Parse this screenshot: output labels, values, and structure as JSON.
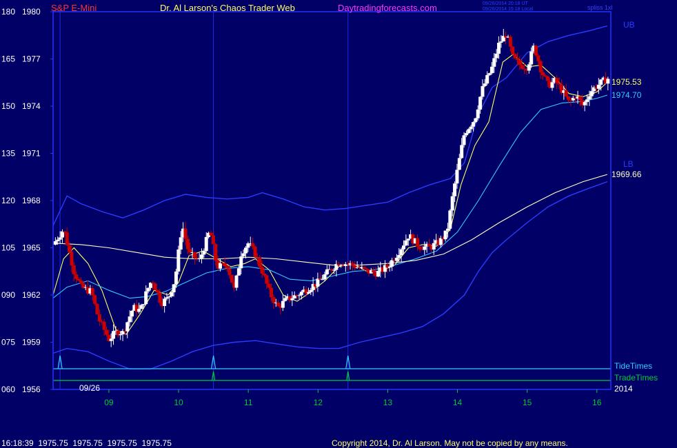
{
  "header": {
    "symbol": "S&P E-Mini",
    "author": "Dr. Al Larson's Chaos Trader Web",
    "site": "Daytradingforecasts.com",
    "timestamp_ut": "09/26/2014 20:18 UT",
    "timestamp_local": "09/26/2014 15:18 Local",
    "chart_id": "spliss 1xl"
  },
  "footer": {
    "last_tick": "16:18:39  1975.75  1975.75  1975.75  1975.75",
    "copyright": "Copyright 2014, Dr. Al Larson. May not be copied by any means."
  },
  "colors": {
    "background": "#000066",
    "frame": "#2233ff",
    "up_bar": "#ffffff",
    "down_bar": "#cc0000",
    "fast_avg": "#ffff66",
    "mid_avg": "#33ccff",
    "slow_avg": "#ffffcc",
    "band": "#2a3cff",
    "tide": "#33ccff",
    "trade": "#00cc33",
    "x_tick": "#00cc33"
  },
  "chart_data": {
    "type": "candlestick",
    "x_unit": "day",
    "x_labels": [
      {
        "x": 9,
        "label": "09"
      },
      {
        "x": 10,
        "label": "10"
      },
      {
        "x": 11,
        "label": "11"
      },
      {
        "x": 12,
        "label": "12"
      },
      {
        "x": 13,
        "label": "13"
      },
      {
        "x": 14,
        "label": "14"
      },
      {
        "x": 15,
        "label": "15"
      },
      {
        "x": 16,
        "label": "16"
      }
    ],
    "xlim": [
      8.2,
      16.2
    ],
    "ylim": [
      1956,
      1980
    ],
    "y_ticks": [
      {
        "left": "180",
        "price": "1980",
        "value": 1980
      },
      {
        "left": "165",
        "price": "1977",
        "value": 1977
      },
      {
        "left": "150",
        "price": "1974",
        "value": 1974
      },
      {
        "left": "135",
        "price": "1971",
        "value": 1971
      },
      {
        "left": "120",
        "price": "1968",
        "value": 1968
      },
      {
        "left": "105",
        "price": "1965",
        "value": 1965
      },
      {
        "left": "090",
        "price": "1962",
        "value": 1962
      },
      {
        "left": "075",
        "price": "1959",
        "value": 1959
      },
      {
        "left": "060",
        "price": "1956",
        "value": 1956
      }
    ],
    "date_label": "09/26",
    "year_label": "2014",
    "band_labels": {
      "upper": "UB",
      "lower": "LB"
    },
    "value_labels": [
      {
        "text": "1975.53",
        "value": 1975.53,
        "series": "fast"
      },
      {
        "text": "1974.70",
        "value": 1974.7,
        "series": "mid"
      },
      {
        "text": "1969.66",
        "value": 1969.66,
        "series": "slow"
      }
    ],
    "event_lines": {
      "tide_label": "TideTimes",
      "trade_label": "TradeTimes",
      "tide_spikes": [
        8.3,
        10.5,
        12.43
      ],
      "trade_spikes": [
        10.5,
        12.43
      ],
      "vertical_markers": [
        8.3,
        10.5,
        12.43
      ]
    },
    "price_path": [
      [
        8.2,
        1965.2
      ],
      [
        8.35,
        1966.2
      ],
      [
        8.5,
        1963.5
      ],
      [
        8.6,
        1962.5
      ],
      [
        8.75,
        1962.2
      ],
      [
        8.85,
        1960.5
      ],
      [
        9.0,
        1959.2
      ],
      [
        9.12,
        1959.7
      ],
      [
        9.2,
        1959.6
      ],
      [
        9.35,
        1961.2
      ],
      [
        9.45,
        1961.0
      ],
      [
        9.55,
        1962.3
      ],
      [
        9.62,
        1963.0
      ],
      [
        9.75,
        1961.5
      ],
      [
        9.85,
        1961.8
      ],
      [
        9.95,
        1963.0
      ],
      [
        10.05,
        1966.5
      ],
      [
        10.15,
        1964.6
      ],
      [
        10.3,
        1964.2
      ],
      [
        10.45,
        1966.1
      ],
      [
        10.55,
        1963.8
      ],
      [
        10.7,
        1963.9
      ],
      [
        10.8,
        1962.3
      ],
      [
        10.9,
        1964.7
      ],
      [
        11.0,
        1965.3
      ],
      [
        11.1,
        1964.6
      ],
      [
        11.2,
        1963.5
      ],
      [
        11.3,
        1962.2
      ],
      [
        11.42,
        1961.2
      ],
      [
        11.55,
        1961.7
      ],
      [
        11.7,
        1962.0
      ],
      [
        11.85,
        1962.4
      ],
      [
        12.0,
        1962.8
      ],
      [
        12.15,
        1963.5
      ],
      [
        12.3,
        1964.1
      ],
      [
        12.5,
        1963.9
      ],
      [
        12.7,
        1963.5
      ],
      [
        12.85,
        1963.4
      ],
      [
        13.0,
        1963.8
      ],
      [
        13.15,
        1964.7
      ],
      [
        13.3,
        1965.8
      ],
      [
        13.45,
        1965.1
      ],
      [
        13.6,
        1965.0
      ],
      [
        13.75,
        1965.4
      ],
      [
        13.85,
        1966.0
      ],
      [
        13.95,
        1968.8
      ],
      [
        14.1,
        1972.3
      ],
      [
        14.25,
        1973.2
      ],
      [
        14.35,
        1975.0
      ],
      [
        14.5,
        1976.5
      ],
      [
        14.6,
        1978.0
      ],
      [
        14.7,
        1978.6
      ],
      [
        14.8,
        1977.0
      ],
      [
        14.9,
        1976.6
      ],
      [
        15.0,
        1976.5
      ],
      [
        15.1,
        1977.8
      ],
      [
        15.2,
        1976.3
      ],
      [
        15.3,
        1975.3
      ],
      [
        15.4,
        1975.6
      ],
      [
        15.5,
        1975.0
      ],
      [
        15.6,
        1974.2
      ],
      [
        15.7,
        1974.7
      ],
      [
        15.8,
        1974.0
      ],
      [
        15.9,
        1974.9
      ],
      [
        16.0,
        1975.3
      ],
      [
        16.15,
        1975.75
      ]
    ],
    "series": [
      {
        "key": "fast",
        "points": [
          [
            8.2,
            1962.0
          ],
          [
            8.35,
            1964.3
          ],
          [
            8.5,
            1965.0
          ],
          [
            8.7,
            1964.0
          ],
          [
            8.9,
            1962.3
          ],
          [
            9.1,
            1959.8
          ],
          [
            9.25,
            1959.5
          ],
          [
            9.45,
            1960.8
          ],
          [
            9.65,
            1962.3
          ],
          [
            9.85,
            1962.0
          ],
          [
            10.0,
            1962.8
          ],
          [
            10.15,
            1964.5
          ],
          [
            10.35,
            1964.8
          ],
          [
            10.55,
            1964.3
          ],
          [
            10.75,
            1963.8
          ],
          [
            10.95,
            1964.0
          ],
          [
            11.1,
            1964.3
          ],
          [
            11.3,
            1963.6
          ],
          [
            11.5,
            1962.0
          ],
          [
            11.7,
            1961.6
          ],
          [
            11.9,
            1962.2
          ],
          [
            12.1,
            1962.9
          ],
          [
            12.3,
            1963.8
          ],
          [
            12.5,
            1964.0
          ],
          [
            12.7,
            1963.5
          ],
          [
            12.9,
            1963.5
          ],
          [
            13.1,
            1963.9
          ],
          [
            13.3,
            1965.0
          ],
          [
            13.5,
            1965.2
          ],
          [
            13.7,
            1965.1
          ],
          [
            13.9,
            1966.2
          ],
          [
            14.05,
            1969.0
          ],
          [
            14.25,
            1971.5
          ],
          [
            14.45,
            1973.0
          ],
          [
            14.65,
            1976.8
          ],
          [
            14.8,
            1977.3
          ],
          [
            15.0,
            1976.5
          ],
          [
            15.2,
            1976.6
          ],
          [
            15.4,
            1975.8
          ],
          [
            15.6,
            1974.8
          ],
          [
            15.8,
            1974.6
          ],
          [
            16.0,
            1974.9
          ],
          [
            16.15,
            1975.53
          ]
        ]
      },
      {
        "key": "mid",
        "points": [
          [
            8.2,
            1961.8
          ],
          [
            8.4,
            1962.5
          ],
          [
            8.7,
            1962.9
          ],
          [
            9.0,
            1962.3
          ],
          [
            9.3,
            1961.8
          ],
          [
            9.55,
            1961.9
          ],
          [
            9.8,
            1962.2
          ],
          [
            10.1,
            1962.8
          ],
          [
            10.4,
            1963.4
          ],
          [
            10.7,
            1963.7
          ],
          [
            11.0,
            1963.8
          ],
          [
            11.3,
            1963.6
          ],
          [
            11.6,
            1963.0
          ],
          [
            11.9,
            1962.9
          ],
          [
            12.2,
            1963.2
          ],
          [
            12.5,
            1963.5
          ],
          [
            12.8,
            1963.6
          ],
          [
            13.1,
            1963.9
          ],
          [
            13.4,
            1964.3
          ],
          [
            13.7,
            1964.8
          ],
          [
            14.0,
            1966.0
          ],
          [
            14.3,
            1968.0
          ],
          [
            14.6,
            1970.2
          ],
          [
            14.9,
            1972.3
          ],
          [
            15.2,
            1973.8
          ],
          [
            15.5,
            1974.2
          ],
          [
            15.8,
            1974.3
          ],
          [
            16.0,
            1974.5
          ],
          [
            16.15,
            1974.7
          ]
        ]
      },
      {
        "key": "slow",
        "points": [
          [
            8.2,
            1965.3
          ],
          [
            8.6,
            1965.2
          ],
          [
            9.0,
            1965.0
          ],
          [
            9.4,
            1964.7
          ],
          [
            9.8,
            1964.4
          ],
          [
            10.2,
            1964.3
          ],
          [
            10.6,
            1964.3
          ],
          [
            11.0,
            1964.4
          ],
          [
            11.4,
            1964.3
          ],
          [
            11.8,
            1964.1
          ],
          [
            12.2,
            1963.9
          ],
          [
            12.6,
            1963.9
          ],
          [
            13.0,
            1964.0
          ],
          [
            13.4,
            1964.2
          ],
          [
            13.8,
            1964.6
          ],
          [
            14.2,
            1965.5
          ],
          [
            14.6,
            1966.6
          ],
          [
            15.0,
            1967.6
          ],
          [
            15.4,
            1968.5
          ],
          [
            15.8,
            1969.2
          ],
          [
            16.15,
            1969.66
          ]
        ]
      },
      {
        "key": "upper_band",
        "points": [
          [
            8.2,
            1966.4
          ],
          [
            8.4,
            1968.3
          ],
          [
            8.6,
            1967.8
          ],
          [
            8.9,
            1967.3
          ],
          [
            9.2,
            1966.9
          ],
          [
            9.5,
            1967.4
          ],
          [
            9.8,
            1968.0
          ],
          [
            10.1,
            1968.4
          ],
          [
            10.4,
            1968.2
          ],
          [
            10.7,
            1968.1
          ],
          [
            11.0,
            1968.2
          ],
          [
            11.2,
            1968.5
          ],
          [
            11.5,
            1968.1
          ],
          [
            11.8,
            1967.6
          ],
          [
            12.1,
            1967.4
          ],
          [
            12.4,
            1967.5
          ],
          [
            12.7,
            1967.7
          ],
          [
            13.0,
            1967.9
          ],
          [
            13.3,
            1968.5
          ],
          [
            13.6,
            1969.0
          ],
          [
            13.9,
            1969.4
          ],
          [
            14.1,
            1970.4
          ],
          [
            14.3,
            1973.5
          ],
          [
            14.5,
            1975.2
          ],
          [
            14.7,
            1975.8
          ],
          [
            15.0,
            1977.4
          ],
          [
            15.3,
            1978.1
          ],
          [
            15.6,
            1978.5
          ],
          [
            15.9,
            1978.8
          ],
          [
            16.15,
            1979.1
          ]
        ]
      },
      {
        "key": "lower_band",
        "points": [
          [
            8.2,
            1958.3
          ],
          [
            8.4,
            1958.6
          ],
          [
            8.7,
            1958.4
          ],
          [
            9.0,
            1957.8
          ],
          [
            9.3,
            1957.3
          ],
          [
            9.6,
            1957.3
          ],
          [
            9.9,
            1957.8
          ],
          [
            10.2,
            1958.4
          ],
          [
            10.5,
            1958.8
          ],
          [
            10.8,
            1959.0
          ],
          [
            11.1,
            1959.1
          ],
          [
            11.4,
            1958.9
          ],
          [
            11.7,
            1958.7
          ],
          [
            12.0,
            1958.6
          ],
          [
            12.3,
            1958.6
          ],
          [
            12.6,
            1959.0
          ],
          [
            12.9,
            1959.3
          ],
          [
            13.2,
            1959.6
          ],
          [
            13.5,
            1960.0
          ],
          [
            13.8,
            1960.8
          ],
          [
            14.1,
            1962.0
          ],
          [
            14.3,
            1963.5
          ],
          [
            14.5,
            1964.7
          ],
          [
            14.7,
            1965.5
          ],
          [
            15.0,
            1966.6
          ],
          [
            15.3,
            1967.6
          ],
          [
            15.6,
            1968.3
          ],
          [
            15.9,
            1968.8
          ],
          [
            16.15,
            1969.2
          ]
        ]
      }
    ]
  }
}
